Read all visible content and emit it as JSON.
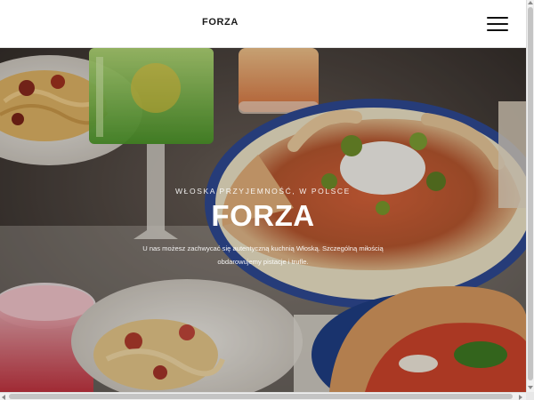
{
  "header": {
    "logo_text": "FORZA",
    "menu_icon": "hamburger-menu-icon"
  },
  "hero": {
    "subtitle": "WŁOSKA PRZYJEMNOŚĆ, W POLSCE",
    "title": "FORZA",
    "description": "U nas możesz zachwycać się autentyczną kuchnią Włoską. Szczególną miłością obdarowujemy pistacje i trufle.",
    "image_subject": "italian-food-table-photo"
  },
  "colors": {
    "header_bg": "#ffffff",
    "text_on_image": "#ffffff",
    "logo": "#1a1a1a"
  }
}
